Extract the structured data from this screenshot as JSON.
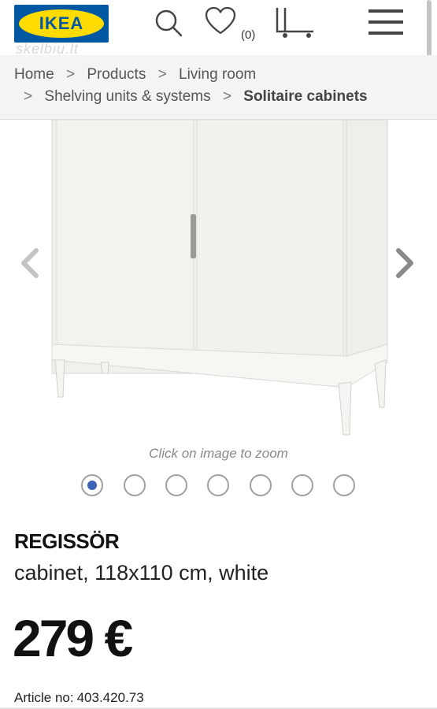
{
  "header": {
    "logo_text": "IKEA",
    "wishlist_count": "(0)",
    "watermark": "skelbiu.lt"
  },
  "breadcrumb": {
    "items": [
      "Home",
      "Products",
      "Living room",
      "Shelving units & systems"
    ],
    "current": "Solitaire cabinets",
    "separator": ">"
  },
  "gallery": {
    "zoom_hint": "Click on image to zoom",
    "total_images": 7,
    "active_index": 0
  },
  "product": {
    "name": "REGISSÖR",
    "description": "cabinet, 118x110 cm, white",
    "price": "279 €",
    "article_label": "Article no:",
    "article_number": "403.420.73"
  },
  "colors": {
    "brand_blue": "#0058a3",
    "brand_yellow": "#ffdb00",
    "active_dot": "#3d62b8"
  }
}
